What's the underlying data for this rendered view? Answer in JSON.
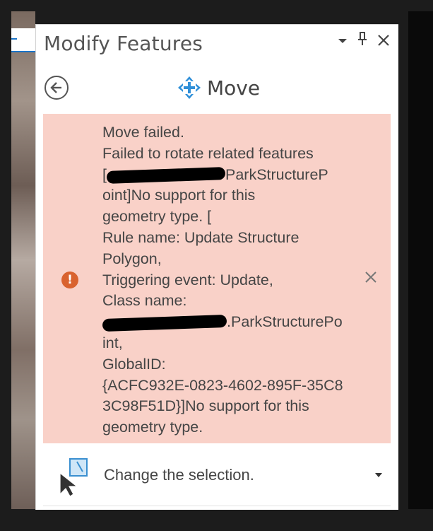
{
  "pane": {
    "title": "Modify Features",
    "controls": {
      "dropdown_icon": "triangle-down",
      "pin_icon": "pin",
      "close_icon": "x"
    }
  },
  "tool": {
    "back_icon": "back-arrow-circle",
    "icon": "move-arrows",
    "label": "Move"
  },
  "error": {
    "icon": "exclamation-circle",
    "lines": {
      "l1": "Move failed.",
      "l2": "Failed to rotate related features",
      "l3_start": "[",
      "l3_end": "ParkStructureP",
      "l4": "oint]No support for this",
      "l5": "geometry type. [",
      "l6": "Rule name: Update Structure",
      "l7": "Polygon,",
      "l8": "Triggering event: Update,",
      "l9": "Class name:",
      "l10_end": ".ParkStructurePo",
      "l11": "int,",
      "l12": "GlobalID:",
      "l13": "{ACFC932E-0823-4602-895F-35C8",
      "l14": "3C98F51D}]No support for this",
      "l15": "geometry type."
    },
    "dismiss_icon": "x",
    "colors": {
      "background": "#f9d1c8",
      "icon": "#d9622e"
    }
  },
  "selection": {
    "icon": "select-cursor",
    "label": "Change the selection.",
    "chevron_icon": "triangle-down"
  }
}
